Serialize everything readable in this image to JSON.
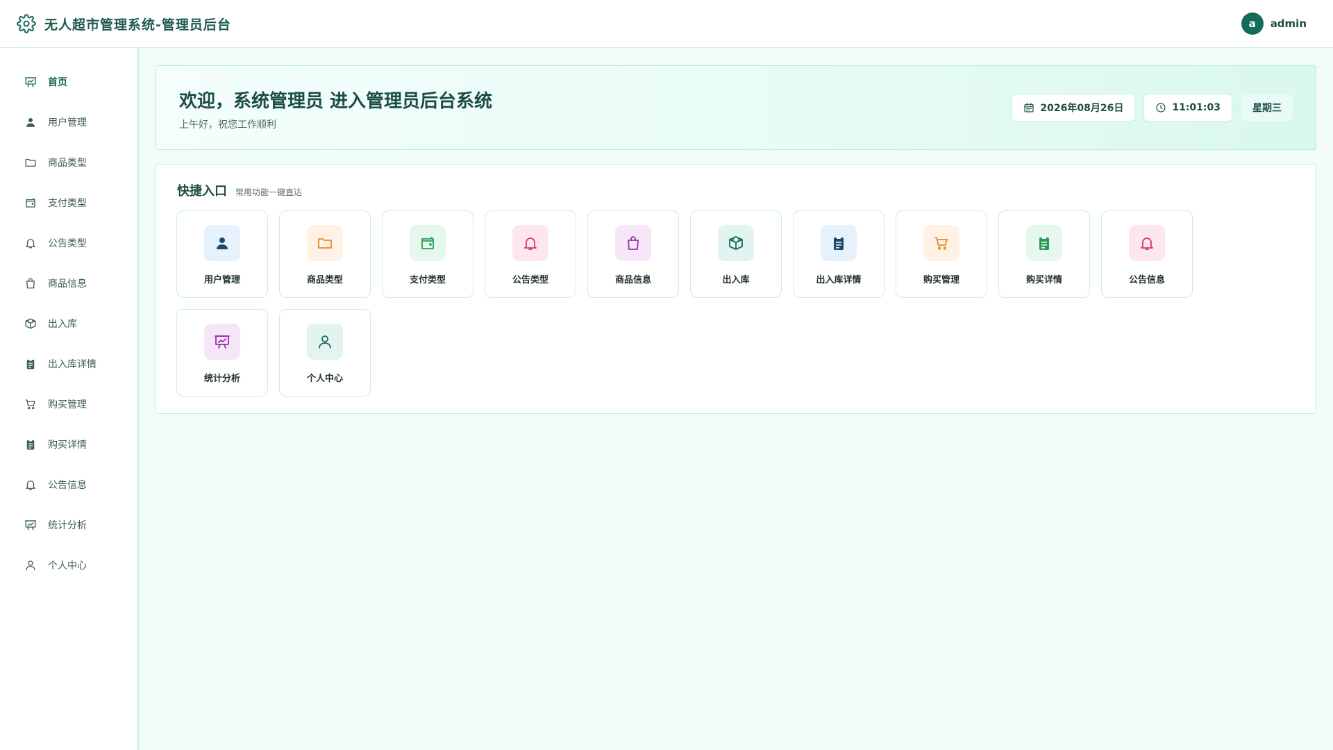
{
  "header": {
    "icon": "gear-icon",
    "title": "无人超市管理系统-管理员后台",
    "user": {
      "avatar_letter": "a",
      "name": "admin"
    }
  },
  "sidebar": {
    "items": [
      {
        "label": "首页",
        "icon": "chart-board-icon",
        "active": true
      },
      {
        "label": "用户管理",
        "icon": "user-filled-icon"
      },
      {
        "label": "商品类型",
        "icon": "folder-icon"
      },
      {
        "label": "支付类型",
        "icon": "wallet-icon"
      },
      {
        "label": "公告类型",
        "icon": "bell-icon"
      },
      {
        "label": "商品信息",
        "icon": "shopping-bag-icon"
      },
      {
        "label": "出入库",
        "icon": "box-icon"
      },
      {
        "label": "出入库详情",
        "icon": "clipboard-icon"
      },
      {
        "label": "购买管理",
        "icon": "cart-icon"
      },
      {
        "label": "购买详情",
        "icon": "clipboard-icon"
      },
      {
        "label": "公告信息",
        "icon": "bell-icon"
      },
      {
        "label": "统计分析",
        "icon": "chart-board-icon"
      },
      {
        "label": "个人中心",
        "icon": "user-outline-icon"
      }
    ]
  },
  "welcome": {
    "title": "欢迎，系统管理员 进入管理员后台系统",
    "subtitle": "上午好，祝您工作顺利",
    "date": "2026年08月26日",
    "time": "11:01:03",
    "weekday": "星期三"
  },
  "quick": {
    "title": "快捷入口",
    "subtitle": "常用功能一键直达",
    "cards": [
      {
        "label": "用户管理",
        "icon": "user-filled-icon",
        "bg": "#e6f1fb",
        "fg": "#1c4a6e"
      },
      {
        "label": "商品类型",
        "icon": "folder-icon",
        "bg": "#fff1e3",
        "fg": "#e8872c"
      },
      {
        "label": "支付类型",
        "icon": "wallet-icon",
        "bg": "#e6f7ee",
        "fg": "#2a9a58"
      },
      {
        "label": "公告类型",
        "icon": "bell-icon",
        "bg": "#fde6ee",
        "fg": "#d63a6a"
      },
      {
        "label": "商品信息",
        "icon": "shopping-bag-icon",
        "bg": "#f6e6f7",
        "fg": "#9b2fa8"
      },
      {
        "label": "出入库",
        "icon": "box-icon",
        "bg": "#e3f3f0",
        "fg": "#1d6b5e"
      },
      {
        "label": "出入库详情",
        "icon": "clipboard-icon",
        "bg": "#e6f1fb",
        "fg": "#1c4a6e"
      },
      {
        "label": "购买管理",
        "icon": "cart-icon",
        "bg": "#fff1e3",
        "fg": "#e8872c"
      },
      {
        "label": "购买详情",
        "icon": "clipboard-icon",
        "bg": "#e6f7ee",
        "fg": "#2a9a58"
      },
      {
        "label": "公告信息",
        "icon": "bell-icon",
        "bg": "#fde6ee",
        "fg": "#d63a6a"
      },
      {
        "label": "统计分析",
        "icon": "chart-board-icon",
        "bg": "#f6e6f7",
        "fg": "#9b2fa8"
      },
      {
        "label": "个人中心",
        "icon": "user-outline-icon",
        "bg": "#e3f3f0",
        "fg": "#1d6b5e"
      }
    ]
  }
}
